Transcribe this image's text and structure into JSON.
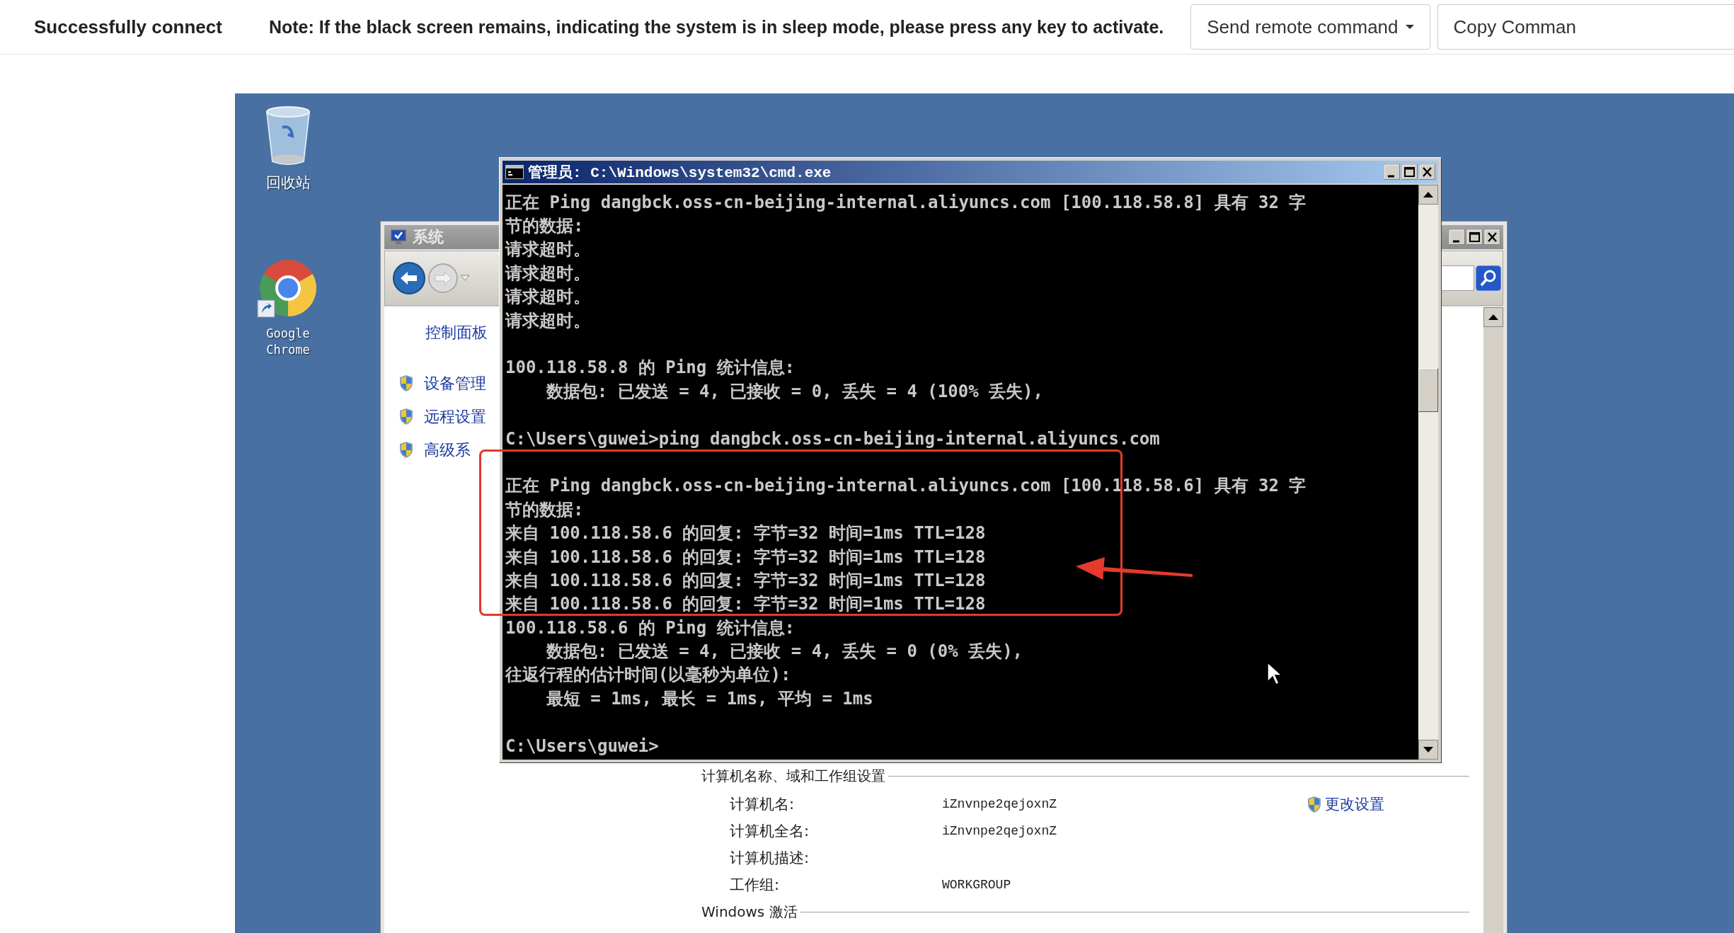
{
  "top_bar": {
    "status": "Successfully connect",
    "note": "Note: If the black screen remains, indicating the system is in sleep mode, please press any key to activate.",
    "buttons": [
      {
        "label": "Send remote command",
        "kind": "dropdown"
      },
      {
        "label": "Copy Comman",
        "kind": "plain"
      }
    ]
  },
  "desktop": {
    "icons": [
      {
        "label": "回收站",
        "kind": "recycle-bin"
      },
      {
        "label": "Google Chrome",
        "kind": "browser"
      }
    ],
    "system_window": {
      "title": "系统",
      "nav_links": [
        "控制面板"
      ],
      "tasks": [
        "设备管理",
        "远程设置",
        "高级系"
      ],
      "section": "计算机名称、域和工作组设置",
      "fields": [
        {
          "label": "计算机名:",
          "value": "iZnvnpe2qejoxnZ"
        },
        {
          "label": "计算机全名:",
          "value": "iZnvnpe2qejoxnZ"
        },
        {
          "label": "计算机描述:"
        },
        {
          "label": "工作组:",
          "value": "WORKGROUP"
        }
      ],
      "change_link": "更改设置",
      "next_section": "Windows 激活"
    },
    "console_window": {
      "title": "管理员: C:\\Windows\\system32\\cmd.exe",
      "blocks": [
        [
          "正在 Ping dangbck.oss-cn-beijing-internal.aliyuncs.com [100.118.58.8] 具有 32 字",
          "节的数据:",
          "请求超时。",
          "请求超时。",
          "请求超时。",
          "请求超时。"
        ],
        [
          "100.118.58.8 的 Ping 统计信息:",
          "    数据包: 已发送 = 4, 已接收 = 0, 丢失 = 4 (100% 丢失),"
        ],
        [
          "C:\\Users\\guwei>ping dangbck.oss-cn-beijing-internal.aliyuncs.com"
        ],
        [
          "正在 Ping dangbck.oss-cn-beijing-internal.aliyuncs.com [100.118.58.6] 具有 32 字",
          "节的数据:",
          "来自 100.118.58.6 的回复: 字节=32 时间=1ms TTL=128",
          "来自 100.118.58.6 的回复: 字节=32 时间=1ms TTL=128",
          "来自 100.118.58.6 的回复: 字节=32 时间=1ms TTL=128",
          "来自 100.118.58.6 的回复: 字节=32 时间=1ms TTL=128",
          "100.118.58.6 的 Ping 统计信息:",
          "    数据包: 已发送 = 4, 已接收 = 4, 丢失 = 0 (0% 丢失),",
          "往返行程的估计时间(以毫秒为单位):",
          "    最短 = 1ms, 最长 = 1ms, 平均 = 1ms"
        ],
        [
          "C:\\Users\\guwei>"
        ]
      ]
    }
  }
}
